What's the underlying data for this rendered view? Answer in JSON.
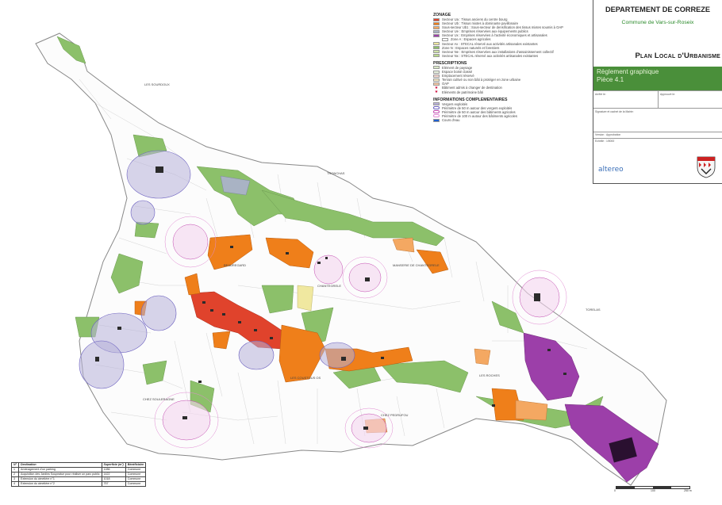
{
  "cartouche": {
    "department": "DEPARTEMENT DE CORREZE",
    "commune": "Commune de Vars-sur-Roseix",
    "plu_title": "Plan Local d'Urbanisme",
    "document": "Règlement graphique",
    "piece": "Pièce 4.1",
    "arrete_label": "Arrêté le:",
    "approuve_label": "Approuvé le:",
    "signature_label": "Signature et cachet de la Mairie:",
    "version_label": "Version : Approbation",
    "echelle_label": "Echelle : 1/5000",
    "logo": "altereo"
  },
  "legend": {
    "zonage_title": "ZONAGE",
    "zonage": [
      {
        "label": "Secteur Ua : Tissus anciens du centre bourg",
        "color": "#e0432c"
      },
      {
        "label": "Secteur Ub : Tissus mixtes à dominante pavillonaire",
        "color": "#ef7f1a"
      },
      {
        "label": "Sous-secteur Ub1 : Sous-secteur de densification des tissus mixtes soumis à OAP",
        "color": "#f4a862"
      },
      {
        "label": "Secteur Ue : Emprises réservées aux équipements publics",
        "color": "#a9b3c4"
      },
      {
        "label": "Secteur Ux : Emprises réservées à l'activité économiques et artisanales",
        "color": "#9c3fa9"
      },
      {
        "label": "Zone A : Espaces agricoles",
        "color": "#ffffff",
        "sub": true
      },
      {
        "label": "Secteur Ax : STECAL réservé aux activités artisanales existantes",
        "color": "#f0e8a0"
      },
      {
        "label": "Zone N : Espaces naturels et forestiers",
        "color": "#8cc06a"
      },
      {
        "label": "Secteur Ne : Emprises réservées aux installations d'assainissement collectif",
        "color": "#cfe3a8"
      },
      {
        "label": "Secteur Nx : STECAL réservé aux activités artisanales existantes",
        "color": "#b9d88a"
      }
    ],
    "prescriptions_title": "PRESCRIPTIONS",
    "prescriptions": [
      {
        "label": "Elément de paysage",
        "color": "#d9e8c6"
      },
      {
        "label": "Espace boisé classé",
        "color": "#e9f2de"
      },
      {
        "label": "Emplacement réservé",
        "color": "#f6d7cf"
      },
      {
        "label": "Terrain cultivé ou non bâti à protéger en zone urbaine",
        "color": "#f4e7c2"
      },
      {
        "label": "OAP",
        "color": "#f3c6a2"
      },
      {
        "label": "Bâtiment admis à changer de destination",
        "symbol": "star"
      },
      {
        "label": "Eléments de patrimoine bâti",
        "symbol": "star"
      }
    ],
    "info_title": "INFORMATIONS COMPLEMENTAIRES",
    "info": [
      {
        "label": "Vergers exploités",
        "color": "#b7b0d8"
      },
      {
        "label": "Périmètre de 50 m autour des vergers exploités",
        "color": "#6a5fc0",
        "ring": true
      },
      {
        "label": "Périmètre de 50 m autour des bâtiments agricoles",
        "color": "#c24ab0",
        "ring": true
      },
      {
        "label": "Périmètre de 100 m autour des bâtiments agricoles",
        "color": "#e18ad2",
        "ring": true
      },
      {
        "label": "Cours d'eau",
        "color": "#1e5fd0"
      }
    ]
  },
  "places": [
    {
      "name": "LES SOURDOUX"
    },
    {
      "name": "TRONCHAS"
    },
    {
      "name": "BEAUREGARD"
    },
    {
      "name": "MANSERIE DE CHANTEGRELE"
    },
    {
      "name": "CHANTEGRELE"
    },
    {
      "name": "TORELAS"
    },
    {
      "name": "LES COUSTOUS OS"
    },
    {
      "name": "LES ROCHES"
    },
    {
      "name": "CHEZ SOULERAGNE"
    },
    {
      "name": "CHEZ PEDRUFOU"
    }
  ],
  "reserved_table": {
    "headers": [
      "N°",
      "Destination",
      "Superficie (m²)",
      "Bénéficiaire"
    ],
    "rows": [
      [
        "1",
        "Aménagement d'un parking",
        "1286",
        "Commune"
      ],
      [
        "2",
        "Acquisition des Jardins Soupeatue pour réaliser un parc public",
        "1422",
        "Commune"
      ],
      [
        "3",
        "Extension du cimetière n°1",
        "1018",
        "Commune"
      ],
      [
        "4",
        "Extension du cimetière n°2",
        "757",
        "Commune"
      ]
    ]
  },
  "scale": {
    "start": "0",
    "middle": "100",
    "end": "250 m"
  },
  "colors": {
    "ua": "#e0432c",
    "ub": "#ef7f1a",
    "ub1": "#f4a862",
    "ux": "#9c3fa9",
    "n": "#8cc06a",
    "ue": "#a9b3c4",
    "ax": "#f0e8a0",
    "verger_ring": "#6a5fc0",
    "agri_ring": "#c24ab0",
    "agri_ring100": "#e18ad2"
  }
}
